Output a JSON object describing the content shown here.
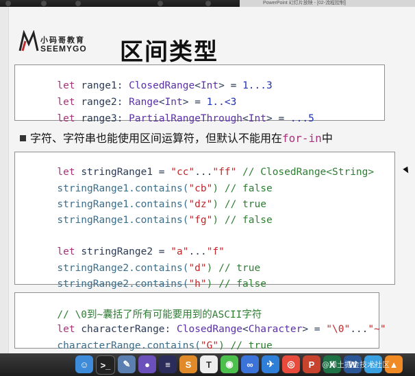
{
  "window": {
    "title": "PowerPoint 幻灯片放映 - [02-流程控制]"
  },
  "logo": {
    "cn": "小码哥教育",
    "en": "SEEMYGO"
  },
  "slide": {
    "title": "区间类型",
    "bullet_prefix": "字符、字符串也能使用区间运算符，但默认不能用在",
    "bullet_code": "for-in",
    "bullet_suffix": "中"
  },
  "code_box1": [
    [
      "let",
      " range1: ",
      "ClosedRange",
      "<",
      "Int",
      "> = ",
      "1...3"
    ],
    [
      "let",
      " range2: ",
      "Range",
      "<",
      "Int",
      "> = ",
      "1..<3"
    ],
    [
      "let",
      " range3: ",
      "PartialRangeThrough",
      "<",
      "Int",
      "> = ",
      "...5"
    ]
  ],
  "code_box2": {
    "l1_kw": "let",
    "l1_a": " stringRange1 = ",
    "l1_s1": "\"cc\"",
    "l1_op": "...",
    "l1_s2": "\"ff\"",
    "l1_cm": " // ClosedRange<String>",
    "l2_a": "stringRange1.contains(",
    "l2_s": "\"cb\"",
    "l2_c": ") // false",
    "l3_a": "stringRange1.contains(",
    "l3_s": "\"dz\"",
    "l3_c": ") // true",
    "l4_a": "stringRange1.contains(",
    "l4_s": "\"fg\"",
    "l4_c": ") // false",
    "l5_kw": "let",
    "l5_a": " stringRange2 = ",
    "l5_s1": "\"a\"",
    "l5_op": "...",
    "l5_s2": "\"f\"",
    "l6_a": "stringRange2.contains(",
    "l6_s": "\"d\"",
    "l6_c": ") // true",
    "l7_a": "stringRange2.contains(",
    "l7_s": "\"h\"",
    "l7_c": ") // false"
  },
  "code_box3": {
    "l1_cm": "// \\0到~囊括了所有可能要用到的ASCII字符",
    "l2_kw": "let",
    "l2_a": " characterRange: ",
    "l2_ty": "ClosedRange",
    "l2_b": "<",
    "l2_ty2": "Character",
    "l2_c": "> = ",
    "l2_s1": "\"\\0\"",
    "l2_op": "...",
    "l2_s2": "\"~\"",
    "l3_a": "characterRange.contains(",
    "l3_s": "\"G\"",
    "l3_c": ") // true"
  },
  "dock": {
    "icons": [
      "finder-icon",
      "terminal-icon",
      "tools-icon",
      "github-icon",
      "eclipse-icon",
      "sublime-icon",
      "typora-icon",
      "wechat-icon",
      "baidu-icon",
      "xcode-icon",
      "chrome-icon",
      "powerpoint-icon",
      "excel-icon",
      "word-icon",
      "safari-icon",
      "vlc-icon"
    ],
    "watermark": "@稀土掘金技术社区"
  },
  "colors": {
    "keyword": "#a8327a",
    "type": "#5a2fa8",
    "number": "#1f2fb0",
    "string": "#c0262a",
    "comment": "#2e7d32"
  }
}
